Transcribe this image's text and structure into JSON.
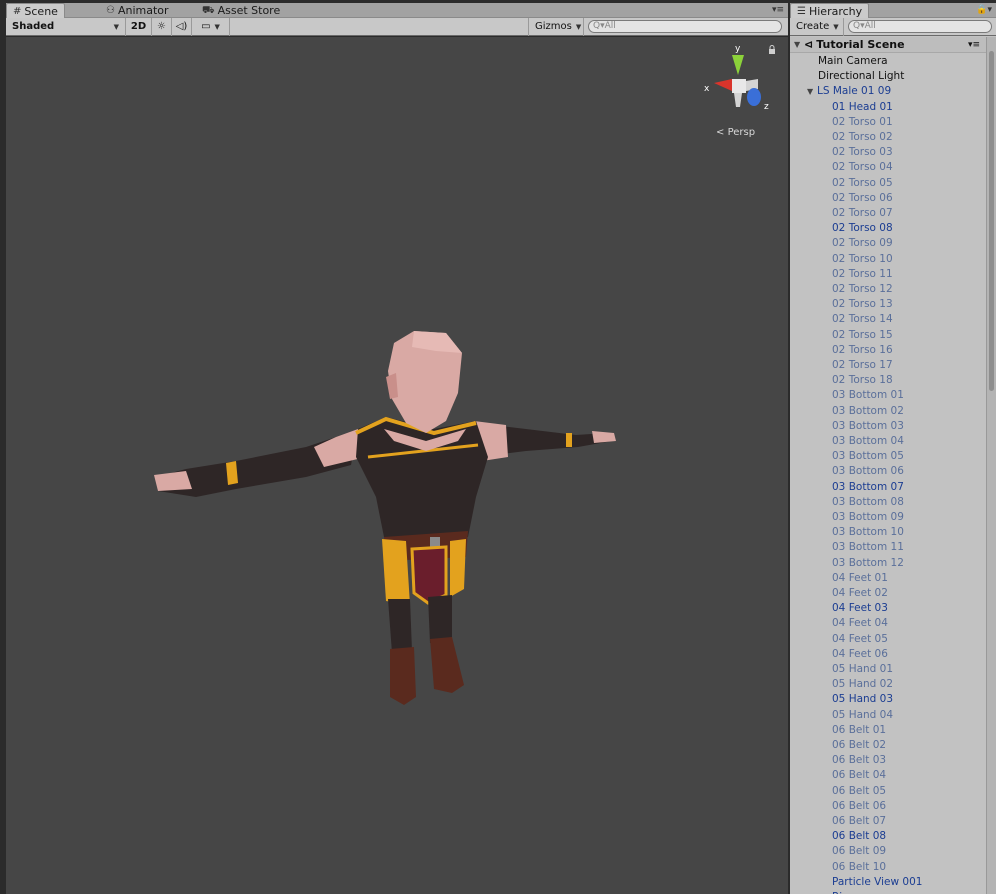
{
  "scene_panel": {
    "tabs": [
      {
        "icon": "grid-icon",
        "label": "Scene"
      },
      {
        "icon": "animator-icon",
        "label": "Animator"
      },
      {
        "icon": "store-icon",
        "label": "Asset Store"
      }
    ],
    "toolbar": {
      "shading_mode": "Shaded",
      "toggle_2d": "2D",
      "gizmos_label": "Gizmos",
      "search_placeholder": "Q▾All"
    },
    "viewport": {
      "projection_label": "Persp",
      "axes": {
        "x": "x",
        "y": "y",
        "z": "z"
      }
    }
  },
  "hierarchy_panel": {
    "tab_label": "Hierarchy",
    "toolbar": {
      "create_label": "Create",
      "search_placeholder": "Q▾All"
    },
    "scene_name": "Tutorial Scene",
    "items": [
      {
        "label": "Main Camera",
        "depth": 1,
        "kind": "obj"
      },
      {
        "label": "Directional Light",
        "depth": 1,
        "kind": "obj"
      },
      {
        "label": "LS Male 01 09",
        "depth": 1,
        "kind": "prefab",
        "expanded": true
      },
      {
        "label": "01 Head 01",
        "depth": 2,
        "kind": "prefab"
      },
      {
        "label": "02 Torso 01",
        "depth": 2,
        "kind": "inactive"
      },
      {
        "label": "02 Torso 02",
        "depth": 2,
        "kind": "inactive"
      },
      {
        "label": "02 Torso 03",
        "depth": 2,
        "kind": "inactive"
      },
      {
        "label": "02 Torso 04",
        "depth": 2,
        "kind": "inactive"
      },
      {
        "label": "02 Torso 05",
        "depth": 2,
        "kind": "inactive"
      },
      {
        "label": "02 Torso 06",
        "depth": 2,
        "kind": "inactive"
      },
      {
        "label": "02 Torso 07",
        "depth": 2,
        "kind": "inactive"
      },
      {
        "label": "02 Torso 08",
        "depth": 2,
        "kind": "prefab"
      },
      {
        "label": "02 Torso 09",
        "depth": 2,
        "kind": "inactive"
      },
      {
        "label": "02 Torso 10",
        "depth": 2,
        "kind": "inactive"
      },
      {
        "label": "02 Torso 11",
        "depth": 2,
        "kind": "inactive"
      },
      {
        "label": "02 Torso 12",
        "depth": 2,
        "kind": "inactive"
      },
      {
        "label": "02 Torso 13",
        "depth": 2,
        "kind": "inactive"
      },
      {
        "label": "02 Torso 14",
        "depth": 2,
        "kind": "inactive"
      },
      {
        "label": "02 Torso 15",
        "depth": 2,
        "kind": "inactive"
      },
      {
        "label": "02 Torso 16",
        "depth": 2,
        "kind": "inactive"
      },
      {
        "label": "02 Torso 17",
        "depth": 2,
        "kind": "inactive"
      },
      {
        "label": "02 Torso 18",
        "depth": 2,
        "kind": "inactive"
      },
      {
        "label": "03 Bottom 01",
        "depth": 2,
        "kind": "inactive"
      },
      {
        "label": "03 Bottom 02",
        "depth": 2,
        "kind": "inactive"
      },
      {
        "label": "03 Bottom 03",
        "depth": 2,
        "kind": "inactive"
      },
      {
        "label": "03 Bottom 04",
        "depth": 2,
        "kind": "inactive"
      },
      {
        "label": "03 Bottom 05",
        "depth": 2,
        "kind": "inactive"
      },
      {
        "label": "03 Bottom 06",
        "depth": 2,
        "kind": "inactive"
      },
      {
        "label": "03 Bottom 07",
        "depth": 2,
        "kind": "prefab"
      },
      {
        "label": "03 Bottom 08",
        "depth": 2,
        "kind": "inactive"
      },
      {
        "label": "03 Bottom 09",
        "depth": 2,
        "kind": "inactive"
      },
      {
        "label": "03 Bottom 10",
        "depth": 2,
        "kind": "inactive"
      },
      {
        "label": "03 Bottom 11",
        "depth": 2,
        "kind": "inactive"
      },
      {
        "label": "03 Bottom 12",
        "depth": 2,
        "kind": "inactive"
      },
      {
        "label": "04 Feet 01",
        "depth": 2,
        "kind": "inactive"
      },
      {
        "label": "04 Feet 02",
        "depth": 2,
        "kind": "inactive"
      },
      {
        "label": "04 Feet 03",
        "depth": 2,
        "kind": "prefab"
      },
      {
        "label": "04 Feet 04",
        "depth": 2,
        "kind": "inactive"
      },
      {
        "label": "04 Feet 05",
        "depth": 2,
        "kind": "inactive"
      },
      {
        "label": "04 Feet 06",
        "depth": 2,
        "kind": "inactive"
      },
      {
        "label": "05 Hand 01",
        "depth": 2,
        "kind": "inactive"
      },
      {
        "label": "05 Hand 02",
        "depth": 2,
        "kind": "inactive"
      },
      {
        "label": "05 Hand 03",
        "depth": 2,
        "kind": "prefab"
      },
      {
        "label": "05 Hand 04",
        "depth": 2,
        "kind": "inactive"
      },
      {
        "label": "06 Belt 01",
        "depth": 2,
        "kind": "inactive"
      },
      {
        "label": "06 Belt 02",
        "depth": 2,
        "kind": "inactive"
      },
      {
        "label": "06 Belt 03",
        "depth": 2,
        "kind": "inactive"
      },
      {
        "label": "06 Belt 04",
        "depth": 2,
        "kind": "inactive"
      },
      {
        "label": "06 Belt 05",
        "depth": 2,
        "kind": "inactive"
      },
      {
        "label": "06 Belt 06",
        "depth": 2,
        "kind": "inactive"
      },
      {
        "label": "06 Belt 07",
        "depth": 2,
        "kind": "inactive"
      },
      {
        "label": "06 Belt 08",
        "depth": 2,
        "kind": "prefab"
      },
      {
        "label": "06 Belt 09",
        "depth": 2,
        "kind": "inactive"
      },
      {
        "label": "06 Belt 10",
        "depth": 2,
        "kind": "inactive"
      },
      {
        "label": "Particle View 001",
        "depth": 2,
        "kind": "prefab"
      },
      {
        "label": "Rig",
        "depth": 2,
        "kind": "prefab"
      }
    ]
  },
  "colors": {
    "viewport_bg": "#464646",
    "panel_bg": "#c2c2c2",
    "prefab_active": "#1b3d92",
    "prefab_inactive": "#5a6f9a",
    "gizmo_x": "#d9342b",
    "gizmo_y": "#8cd23a",
    "gizmo_z": "#3a6fd8",
    "outfit_dark": "#2e2626",
    "outfit_trim": "#e3a21e",
    "skin": "#d9a9a4",
    "belt_cloth": "#6a1e2c"
  }
}
